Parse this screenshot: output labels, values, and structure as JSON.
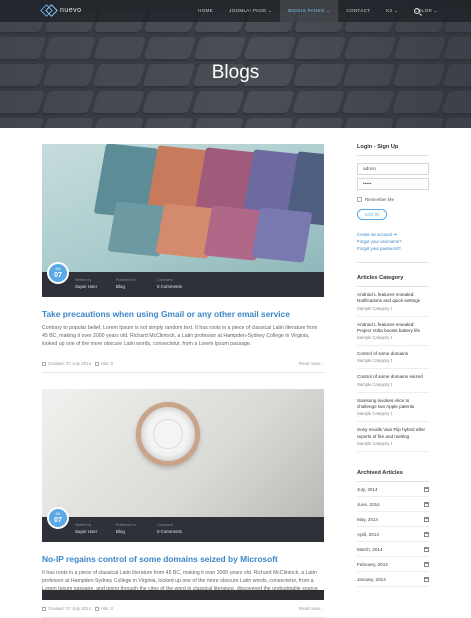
{
  "nav": {
    "logo": "nuevo",
    "items": [
      "HOME",
      "JOOMLA! PAGE ⌄",
      "BONUS PAGES ⌄",
      "CONTACT",
      "K2 ⌄",
      "COLOR ⌄"
    ],
    "active_index": 2
  },
  "page_title": "Blogs",
  "posts": [
    {
      "date_month": "JUL",
      "date_day": "07",
      "written_by_label": "Written by",
      "written_by": "Super User",
      "published_in_label": "Published in",
      "published_in": "Blog",
      "comment_label": "Comment",
      "comments": "0 Comments",
      "title": "Take precautions when using Gmail or any other email service",
      "text": "Contrary to popular belief, Lorem Ipsum is not simply random text. It has roots in a piece of classical Latin literature from 45 BC, making it over 2000 years old. Richard McClintock, a Latin professor at Hampden-Sydney College in Virginia, looked up one of the more obscure Latin words, consectetur, from a Lorem Ipsum passage.",
      "created": "Created: 07 July 2014",
      "hits": "Hits: 0",
      "read_more": "Read more..."
    },
    {
      "date_month": "JUL",
      "date_day": "07",
      "written_by_label": "Written by",
      "written_by": "Super User",
      "published_in_label": "Published in",
      "published_in": "Blog",
      "comment_label": "Comment",
      "comments": "0 Comments",
      "title": "No-IP regains control of some domains seized by Microsoft",
      "text": "It has roots in a piece of classical Latin literature from 45 BC, making it over 2000 years old. Richard McClintock, a Latin professor at Hampden-Sydney College in Virginia, looked up one of the more obscure Latin words, consectetur, from a Lorem Ipsum passage, and going through the cites of the word in classical literature, discovered the undoubtable source.",
      "created": "Created: 07 July 2014",
      "hits": "Hits: 0",
      "read_more": "Read more..."
    }
  ],
  "sidebar": {
    "login_title": "Login - Sign Up",
    "username": "admin",
    "password": "•••••",
    "remember": "Remember Me",
    "login_button": "LOG IN",
    "links": [
      "Create an account ➔",
      "Forgot your username?",
      "Forgot your password?"
    ],
    "articles_title": "Articles Category",
    "articles": [
      {
        "title": "Android L features revealed: Notifications and quick settings",
        "category": "Sample Category 1"
      },
      {
        "title": "Android L features revealed: Project Volta boosts battery life",
        "category": "Sample Category 1"
      },
      {
        "title": "Control of some domains",
        "category": "Sample Category 1"
      },
      {
        "title": "Control of some domains seized",
        "category": "Sample Category 1"
      },
      {
        "title": "Samsung invokes Alice to challenge two Apple patents",
        "category": "Sample Category 1"
      },
      {
        "title": "Sony recalls Vaio Flip hybrid after reports of fire and melting",
        "category": "Sample Category 1"
      }
    ],
    "archived_title": "Archived Articles",
    "archived": [
      "July, 2014",
      "June, 2014",
      "May, 2014",
      "April, 2014",
      "March, 2014",
      "February, 2014",
      "January, 2014"
    ]
  },
  "colors": {
    "accent": "#3b86c7",
    "dark_bar": "#2e3138",
    "badge": "#5aa9e6"
  }
}
